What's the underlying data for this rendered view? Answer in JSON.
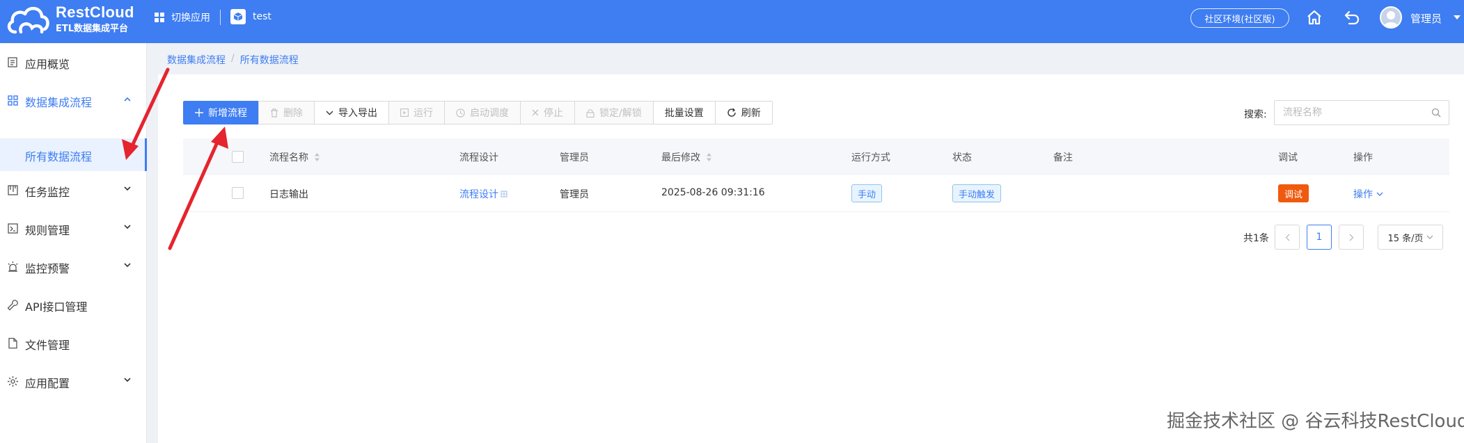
{
  "header": {
    "logo_name": "RestCloud",
    "logo_sub": "ETL数据集成平台",
    "switch_app_label": "切换应用",
    "current_app": "test",
    "env_label": "社区环境(社区版)",
    "user_name": "管理员"
  },
  "sidebar": {
    "items": [
      {
        "label": "应用概览",
        "icon": "overview-icon"
      },
      {
        "label": "数据集成流程",
        "icon": "grid-icon"
      },
      {
        "label": "任务监控",
        "icon": "monitor-icon"
      },
      {
        "label": "规则管理",
        "icon": "terminal-icon"
      },
      {
        "label": "监控预警",
        "icon": "alarm-icon"
      },
      {
        "label": "API接口管理",
        "icon": "wrench-icon"
      },
      {
        "label": "文件管理",
        "icon": "file-icon"
      },
      {
        "label": "应用配置",
        "icon": "gear-icon"
      }
    ],
    "active_sub": "所有数据流程"
  },
  "breadcrumb": {
    "root": "数据集成流程",
    "separator": "/",
    "current": "所有数据流程"
  },
  "toolbar": {
    "new_flow": "新增流程",
    "delete": "删除",
    "import_export": "导入导出",
    "run": "运行",
    "start_schedule": "启动调度",
    "stop": "停止",
    "lock_unlock": "锁定/解锁",
    "batch_settings": "批量设置",
    "refresh": "刷新"
  },
  "search": {
    "label": "搜索:",
    "placeholder": "流程名称"
  },
  "table": {
    "columns": {
      "name": "流程名称",
      "design": "流程设计",
      "admin": "管理员",
      "modified": "最后修改",
      "run_mode": "运行方式",
      "status": "状态",
      "remark": "备注",
      "debug": "调试",
      "ops": "操作"
    },
    "rows": [
      {
        "name": "日志输出",
        "design": "流程设计",
        "admin": "管理员",
        "modified": "2025-08-26 09:31:16",
        "run_mode": "手动",
        "status": "手动触发",
        "remark": "",
        "debug": "调试",
        "ops": "操作"
      }
    ]
  },
  "pagination": {
    "total": "共1条",
    "current_page": "1",
    "page_size": "15 条/页"
  },
  "watermark": "掘金技术社区 @ 谷云科技RestCloud",
  "colors": {
    "primary": "#3e7df2",
    "debug": "#f05a0f",
    "annotation_arrow": "#e5242e"
  }
}
